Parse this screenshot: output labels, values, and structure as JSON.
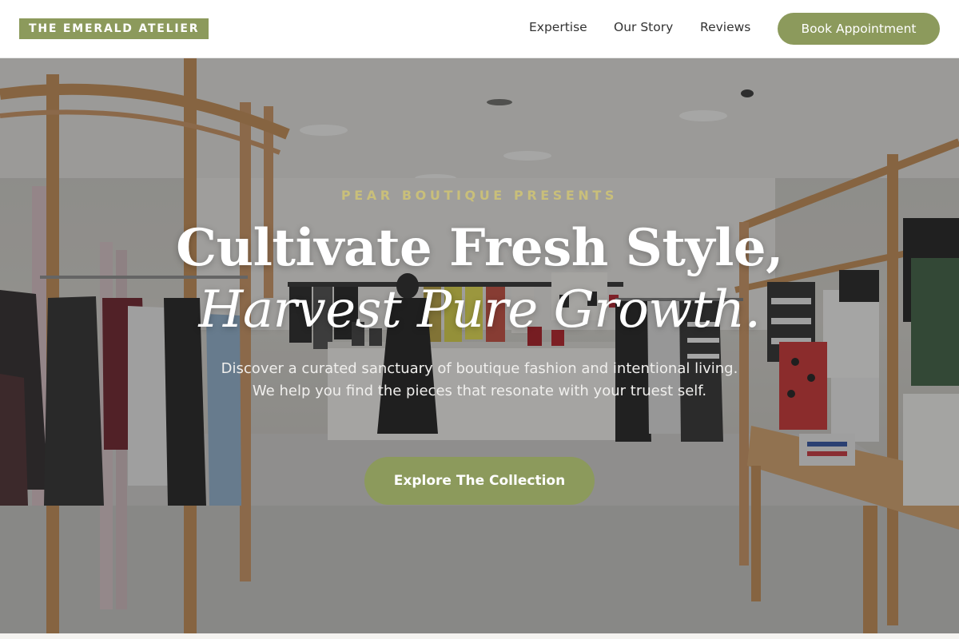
{
  "header": {
    "logo_text": "THE EMERALD ATELIER",
    "nav": [
      {
        "label": "Expertise"
      },
      {
        "label": "Our Story"
      },
      {
        "label": "Reviews"
      }
    ],
    "cta_label": "Book Appointment"
  },
  "hero": {
    "eyebrow": "PEAR BOUTIQUE PRESENTS",
    "headline_line1": "Cultivate Fresh Style,",
    "headline_line2": "Harvest Pure Growth.",
    "description": "Discover a curated sanctuary of boutique fashion and intentional living. We help you find the pieces that resonate with your truest self.",
    "cta_label": "Explore The Collection",
    "background_image": "boutique-store-interior"
  },
  "colors": {
    "accent": "#8c9a5c",
    "eyebrow": "#c9bf7a",
    "header_bg": "#ffffff",
    "nav_text": "#333333"
  }
}
